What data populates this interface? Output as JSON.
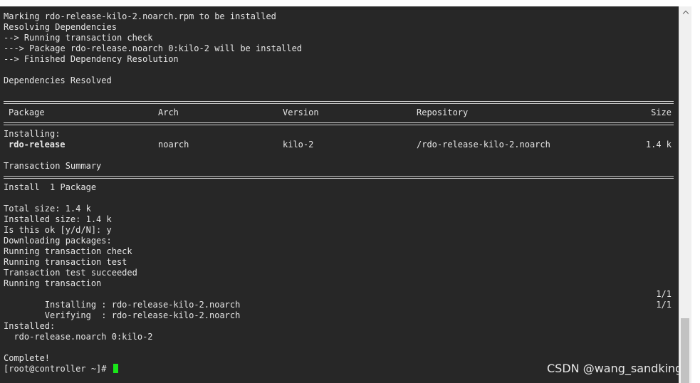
{
  "terminal": {
    "log_top": [
      "Marking rdo-release-kilo-2.noarch.rpm to be installed",
      "Resolving Dependencies",
      "--> Running transaction check",
      "---> Package rdo-release.noarch 0:kilo-2 will be installed",
      "--> Finished Dependency Resolution",
      "",
      "Dependencies Resolved",
      ""
    ],
    "table": {
      "headers": {
        "package": "Package",
        "arch": "Arch",
        "version": "Version",
        "repository": "Repository",
        "size": "Size"
      },
      "installing_label": "Installing:",
      "row": {
        "package": "rdo-release",
        "arch": "noarch",
        "version": "kilo-2",
        "repository": "/rdo-release-kilo-2.noarch",
        "size": "1.4 k"
      },
      "transaction_summary": "Transaction Summary",
      "install_summary": "Install  1 Package"
    },
    "log_mid": [
      "Total size: 1.4 k",
      "Installed size: 1.4 k",
      "Is this ok [y/d/N]: y",
      "Downloading packages:",
      "Running transaction check",
      "Running transaction test",
      "Transaction test succeeded",
      "Running transaction"
    ],
    "progress": [
      {
        "text": "  Installing : rdo-release-kilo-2.noarch",
        "count": "1/1"
      },
      {
        "text": "  Verifying  : rdo-release-kilo-2.noarch",
        "count": "1/1"
      }
    ],
    "installed_label": "Installed:",
    "installed_item": "  rdo-release.noarch 0:kilo-2",
    "complete": "Complete!",
    "prompt": "[root@controller ~]# "
  },
  "watermark": "CSDN @wang_sandking",
  "colors": {
    "background": "#272727",
    "text": "#e6e6e6",
    "cursor": "#19e619"
  }
}
